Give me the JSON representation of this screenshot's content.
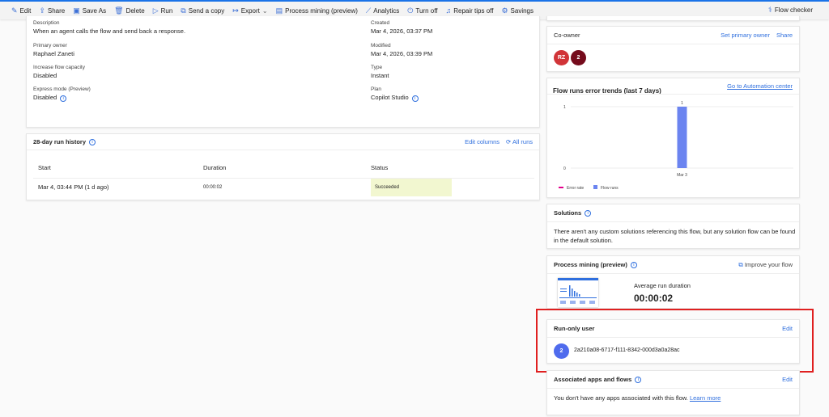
{
  "toolbar": {
    "items": [
      {
        "label": "Edit",
        "icon": "pencil-icon",
        "glyph": "✎"
      },
      {
        "label": "Share",
        "icon": "share-icon",
        "glyph": "⇪"
      },
      {
        "label": "Save As",
        "icon": "save-as-icon",
        "glyph": "▣"
      },
      {
        "label": "Delete",
        "icon": "trash-icon",
        "glyph": "🗑"
      },
      {
        "label": "Run",
        "icon": "play-icon",
        "glyph": "▷"
      },
      {
        "label": "Send a copy",
        "icon": "copy-icon",
        "glyph": "⧉"
      },
      {
        "label": "Export",
        "icon": "export-icon",
        "glyph": "↦"
      },
      {
        "label": "Process mining (preview)",
        "icon": "process-mining-icon",
        "glyph": "▤"
      },
      {
        "label": "Analytics",
        "icon": "analytics-icon",
        "glyph": "⟋"
      },
      {
        "label": "Turn off",
        "icon": "power-icon",
        "glyph": "⏻"
      },
      {
        "label": "Repair tips off",
        "icon": "bell-icon",
        "glyph": "♫"
      },
      {
        "label": "Savings",
        "icon": "savings-icon",
        "glyph": "⚙"
      }
    ],
    "flow_checker": "Flow checker"
  },
  "details": {
    "description_label": "Description",
    "description": "When an agent calls the flow and send back a response.",
    "owner_label": "Primary owner",
    "owner": "Raphael Zaneti",
    "capacity_label": "Increase flow capacity",
    "capacity": "Disabled",
    "express_label": "Express mode (Preview)",
    "express": "Disabled",
    "created_label": "Created",
    "created": "Mar 4, 2026, 03:37 PM",
    "modified_label": "Modified",
    "modified": "Mar 4, 2026, 03:39 PM",
    "type_label": "Type",
    "type": "Instant",
    "plan_label": "Plan",
    "plan": "Copilot Studio"
  },
  "history": {
    "title": "28-day run history",
    "edit_columns": "Edit columns",
    "all_runs": "All runs",
    "columns": [
      "Start",
      "Duration",
      "Status"
    ],
    "rows": [
      {
        "start": "Mar 4, 03:44 PM (1 d ago)",
        "duration": "00:00:02",
        "status": "Succeeded"
      }
    ],
    "status_color": "#f2f7d0"
  },
  "coowner": {
    "title": "Co-owner",
    "set_primary": "Set primary owner",
    "share": "Share",
    "avatars": [
      {
        "text": "RZ",
        "color": "#d13438"
      },
      {
        "text": "2",
        "color": "#750b1c"
      }
    ]
  },
  "trends": {
    "title": "Flow runs error trends (last 7 days)",
    "link": "Go to Automation center"
  },
  "chart_data": {
    "type": "bar",
    "categories": [
      "Mar 3"
    ],
    "series": [
      {
        "name": "Flow runs",
        "values": [
          1
        ],
        "color": "#6b84f0"
      },
      {
        "name": "Error rate",
        "values": [
          0
        ],
        "color": "#e3008c"
      }
    ],
    "ylim": [
      0,
      1
    ],
    "yticks": [
      "0",
      "1"
    ],
    "data_labels": [
      "1"
    ],
    "legend": "bottom-left"
  },
  "solutions": {
    "title": "Solutions",
    "text": "There aren't any custom solutions referencing this flow, but any solution flow can be found in the default solution."
  },
  "process": {
    "title": "Process mining (preview)",
    "improve": "Improve your flow",
    "avg_label": "Average run duration",
    "avg": "00:00:02"
  },
  "runonly": {
    "title": "Run-only user",
    "edit": "Edit",
    "avatar": "2",
    "avatar_color": "#4f6bed",
    "user": "2a210a08-6717-f111-8342-000d3a0a28ac"
  },
  "assoc": {
    "title": "Associated apps and flows",
    "edit": "Edit",
    "text": "You don't have any apps associated with this flow.",
    "learn": "Learn more"
  }
}
